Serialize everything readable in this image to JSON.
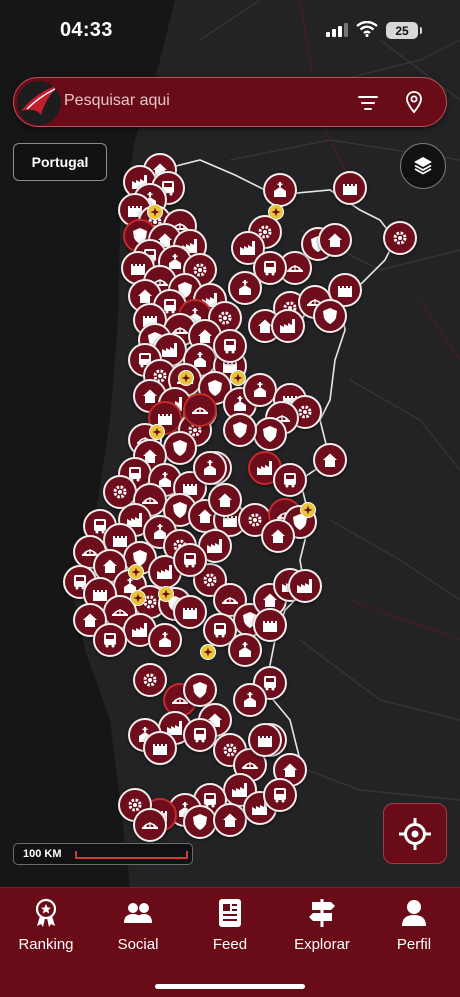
{
  "status_bar": {
    "time": "04:33",
    "battery": "25"
  },
  "search": {
    "placeholder": "Pesquisar aqui",
    "filter_icon": "filter-icon",
    "location_icon": "map-pin-icon"
  },
  "country_chip": "Portugal",
  "scale": {
    "label": "100 KM"
  },
  "map_controls": {
    "layers_icon": "layers-icon",
    "locate_icon": "crosshair-icon"
  },
  "tabs": [
    {
      "label": "Ranking",
      "icon": "ranking-medal-icon"
    },
    {
      "label": "Social",
      "icon": "users-icon"
    },
    {
      "label": "Feed",
      "icon": "news-icon"
    },
    {
      "label": "Explorar",
      "icon": "signpost-icon"
    },
    {
      "label": "Perfil",
      "icon": "user-icon"
    }
  ],
  "colors": {
    "brand": "#6a0c17",
    "marker": "#6e0d1c",
    "star": "#e9c53b",
    "map_bg": "#232325"
  }
}
